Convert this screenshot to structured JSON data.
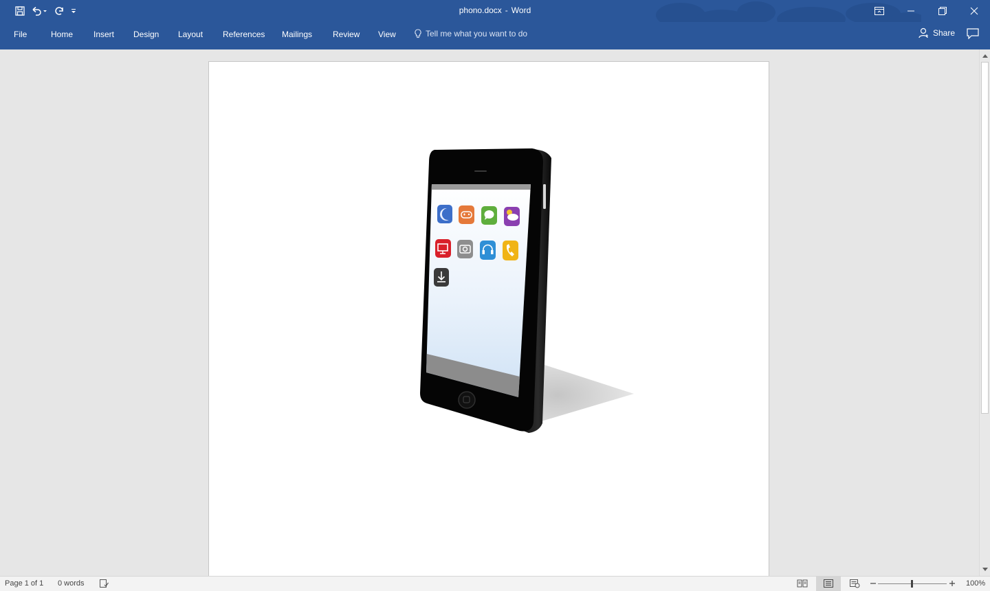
{
  "titlebar": {
    "document_name": "phono.docx",
    "separator": "-",
    "app_name": "Word"
  },
  "ribbon": {
    "tabs": [
      "File",
      "Home",
      "Insert",
      "Design",
      "Layout",
      "References",
      "Mailings",
      "Review",
      "View"
    ],
    "tell_me": "Tell me what you want to do",
    "share": "Share"
  },
  "document": {
    "image_description_icons": [
      "moon-app-icon",
      "gamepad-app-icon",
      "messages-app-icon",
      "weather-app-icon",
      "tv-app-icon",
      "camera-app-icon",
      "headphones-app-icon",
      "phone-app-icon",
      "download-app-icon"
    ]
  },
  "status": {
    "page": "Page 1 of 1",
    "words": "0 words",
    "zoom": "100%"
  },
  "colors": {
    "accent": "#2b579a",
    "canvas": "#e6e6e6",
    "statusbar": "#f3f3f3"
  }
}
